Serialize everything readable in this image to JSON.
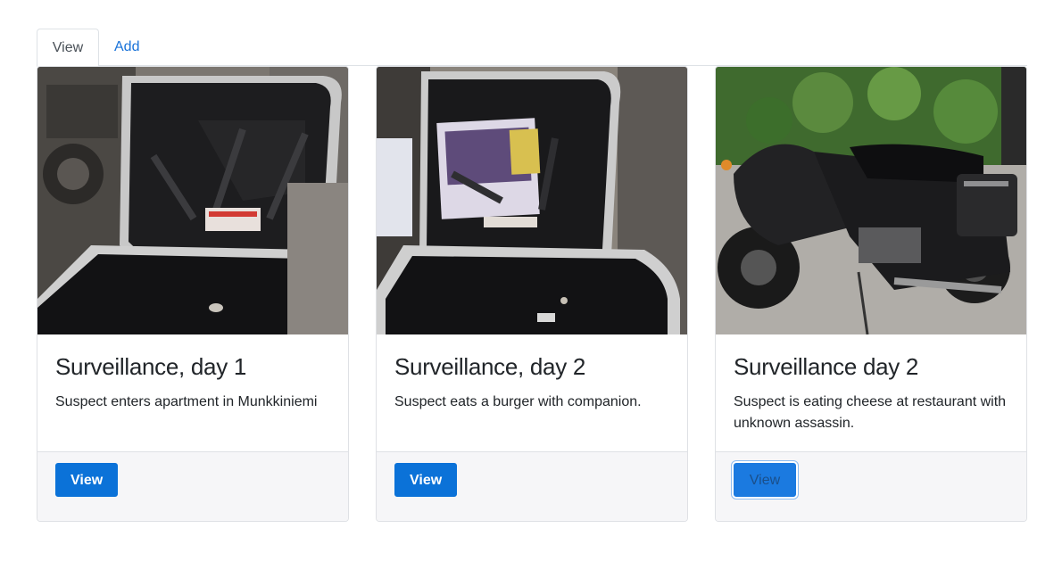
{
  "tabs": [
    {
      "label": "View",
      "active": true
    },
    {
      "label": "Add",
      "active": false
    }
  ],
  "cards": [
    {
      "image": "motorcycle-open-saddlebag",
      "title": "Surveillance, day 1",
      "text": "Suspect enters apartment in Munkkiniemi",
      "button": "View"
    },
    {
      "image": "saddlebag-with-yamaha-manual",
      "title": "Surveillance, day 2",
      "text": "Suspect eats a burger with companion.",
      "button": "View"
    },
    {
      "image": "black-motorcycle-side-view",
      "title": "Surveillance day 2",
      "text": "Suspect is eating cheese at restaurant with unknown assassin.",
      "button": "View"
    }
  ],
  "colors": {
    "accent": "#0b72d8",
    "link": "#1a73d9",
    "footer_bg": "#f6f6f8",
    "border": "#dfe1e5"
  }
}
